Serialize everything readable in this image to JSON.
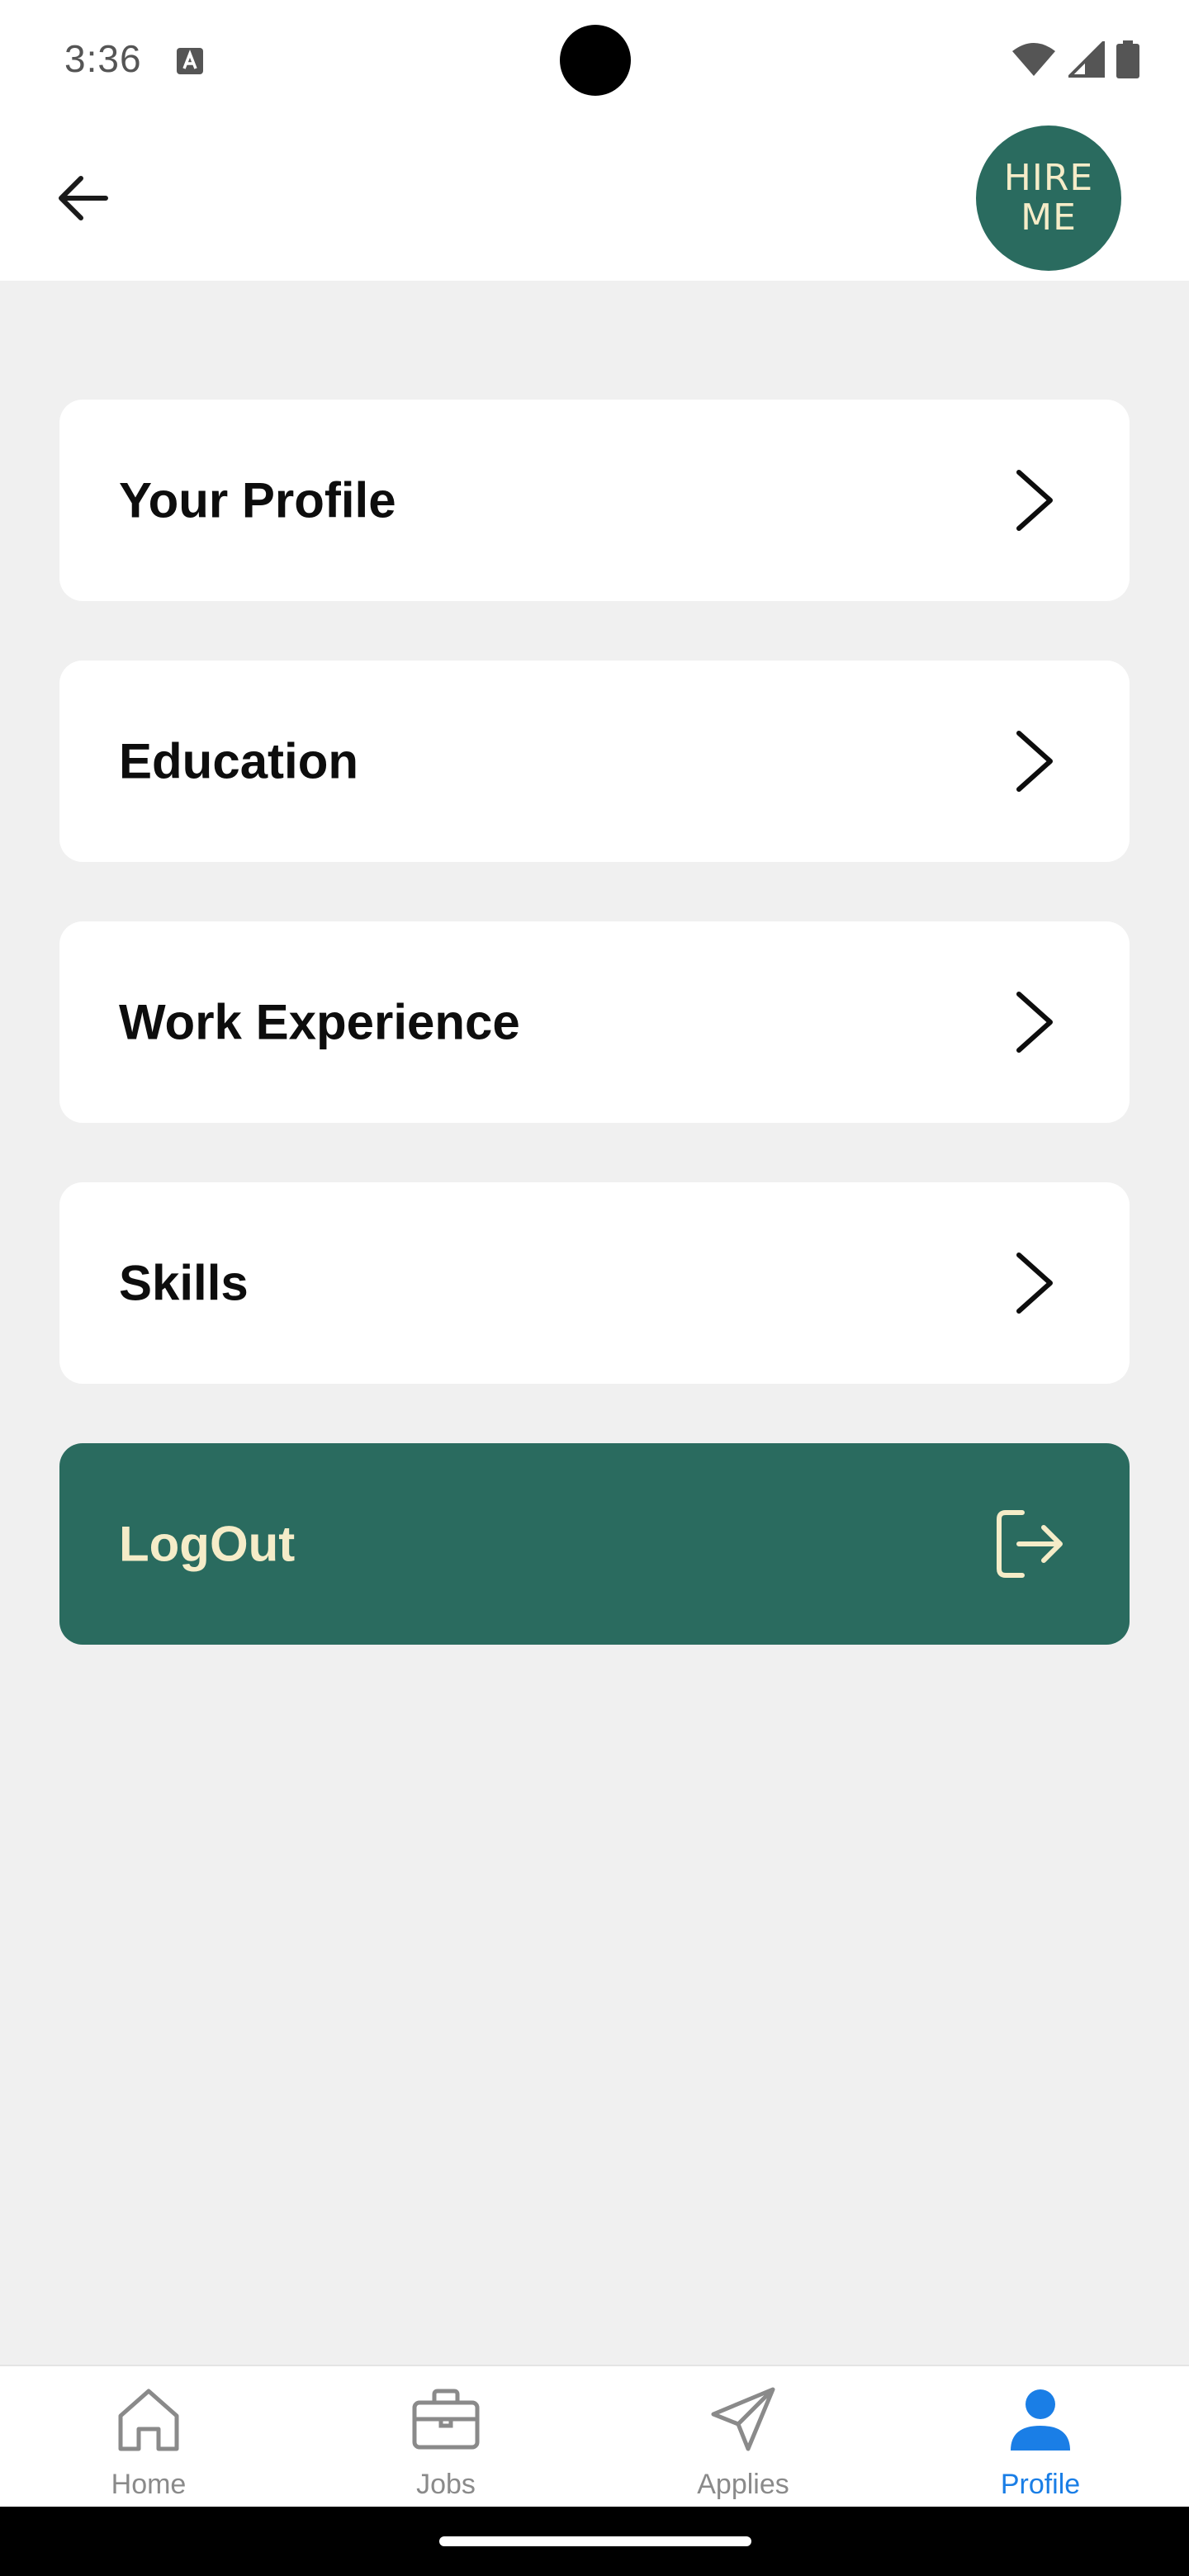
{
  "status_bar": {
    "time": "3:36"
  },
  "app_bar": {
    "logo_line1": "HIRE",
    "logo_line2": "ME"
  },
  "menu": {
    "items": [
      {
        "label": "Your Profile"
      },
      {
        "label": "Education"
      },
      {
        "label": "Work Experience"
      },
      {
        "label": "Skills"
      }
    ],
    "logout_label": "LogOut"
  },
  "bottom_nav": {
    "items": [
      {
        "label": "Home",
        "icon": "home-icon",
        "active": false
      },
      {
        "label": "Jobs",
        "icon": "briefcase-icon",
        "active": false
      },
      {
        "label": "Applies",
        "icon": "send-icon",
        "active": false
      },
      {
        "label": "Profile",
        "icon": "person-icon",
        "active": true
      }
    ]
  },
  "colors": {
    "brand": "#2a6b5f",
    "brand_text": "#f5ecc8",
    "active_nav": "#1a7ee6",
    "background": "#f0f0f0"
  }
}
